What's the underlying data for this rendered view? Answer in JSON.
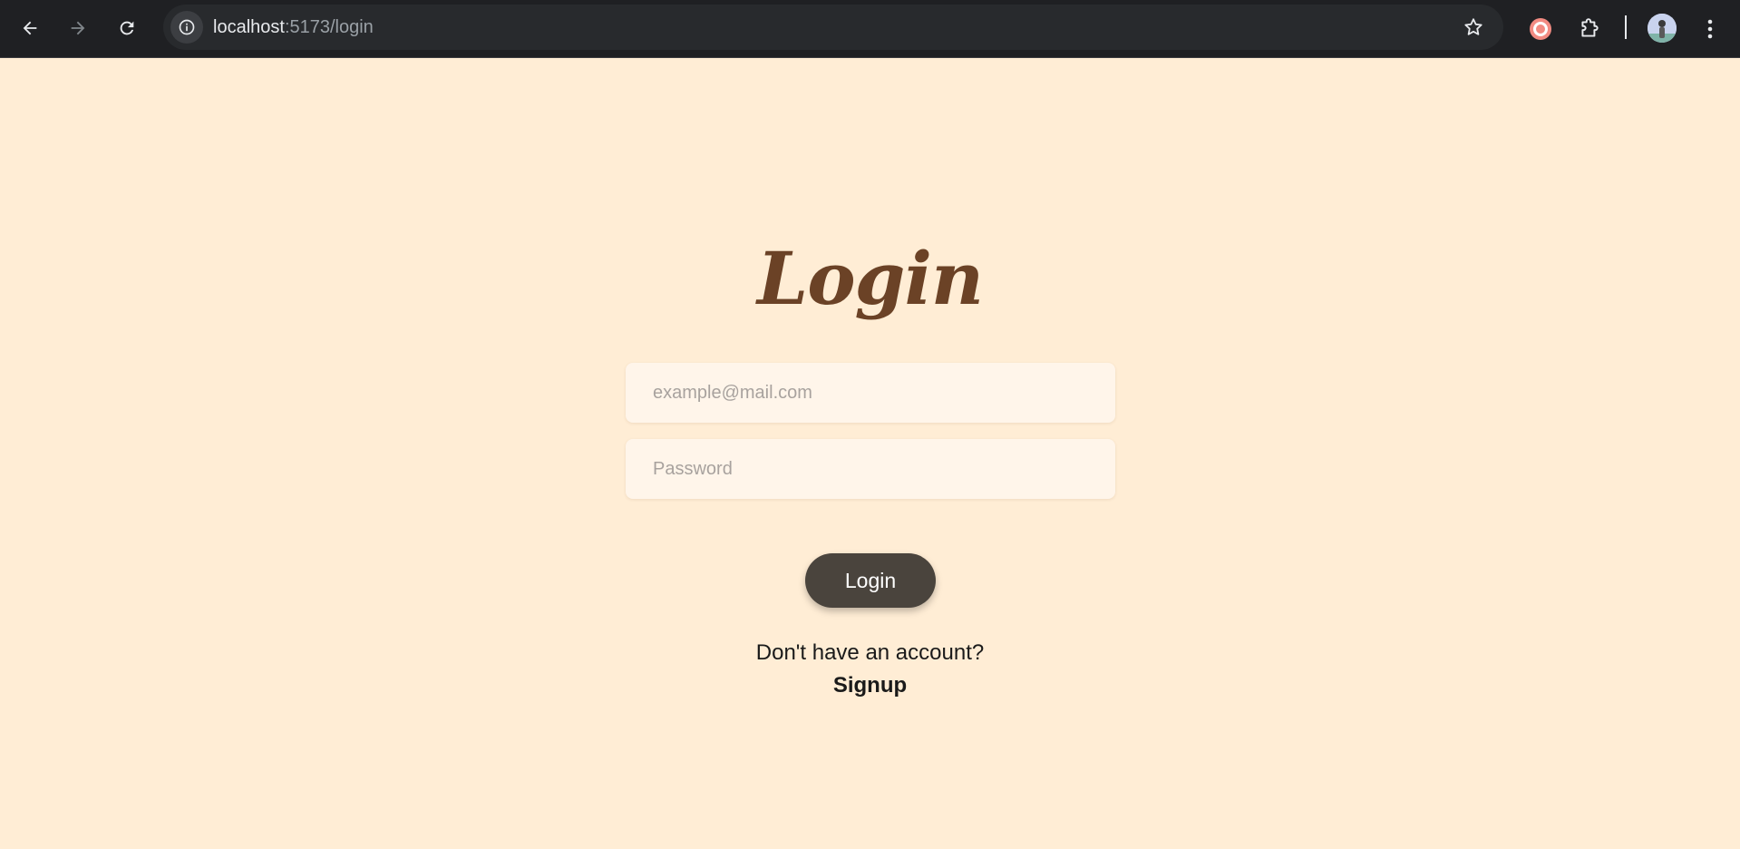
{
  "browser": {
    "url_host": "localhost",
    "url_path": ":5173/login",
    "icons": {
      "back": "arrow-left-icon",
      "forward": "arrow-right-icon",
      "reload": "reload-icon",
      "site_info": "info-icon",
      "bookmark": "star-icon",
      "extension_record": "record-icon",
      "extensions": "puzzle-icon",
      "menu": "kebab-menu-icon"
    }
  },
  "page": {
    "title": "Login",
    "email_placeholder": "example@mail.com",
    "password_placeholder": "Password",
    "login_button": "Login",
    "signup_prompt": "Don't have an account?",
    "signup_link": "Signup"
  },
  "colors": {
    "background": "#FFEDD5",
    "title": "#6B4226",
    "input_bg": "#FFF5EA",
    "button_bg": "#4A443D",
    "button_text": "#FFFFFF"
  }
}
